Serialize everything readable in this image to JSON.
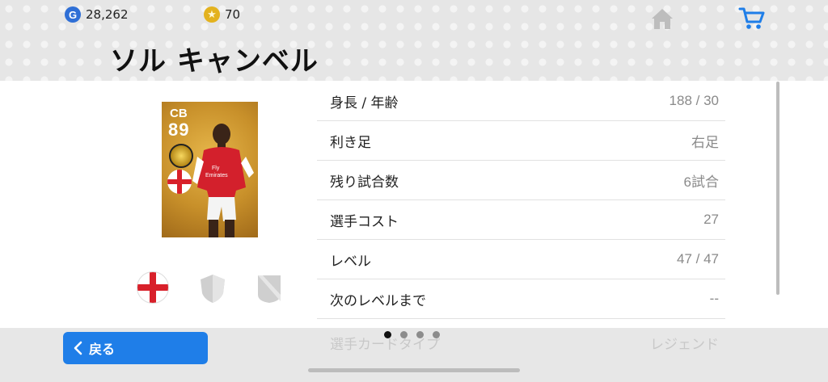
{
  "header": {
    "gp": "28,262",
    "coins": "70",
    "player_name": "ソル キャンベル"
  },
  "card": {
    "position": "CB",
    "rating": "89"
  },
  "stats": [
    {
      "label": "身長 / 年齢",
      "value": "188 / 30"
    },
    {
      "label": "利き足",
      "value": "右足"
    },
    {
      "label": "残り試合数",
      "value": "6試合"
    },
    {
      "label": "選手コスト",
      "value": "27"
    },
    {
      "label": "レベル",
      "value": "47 / 47"
    },
    {
      "label": "次のレベルまで",
      "value": "--"
    },
    {
      "label": "選手カードタイプ",
      "value": "レジェンド"
    }
  ],
  "footer": {
    "back_label": "戻る"
  },
  "pager": {
    "count": 4,
    "active": 1
  },
  "colors": {
    "accent": "#1f7ee8",
    "card_gold": "#c8902a",
    "england_red": "#d8202a"
  }
}
